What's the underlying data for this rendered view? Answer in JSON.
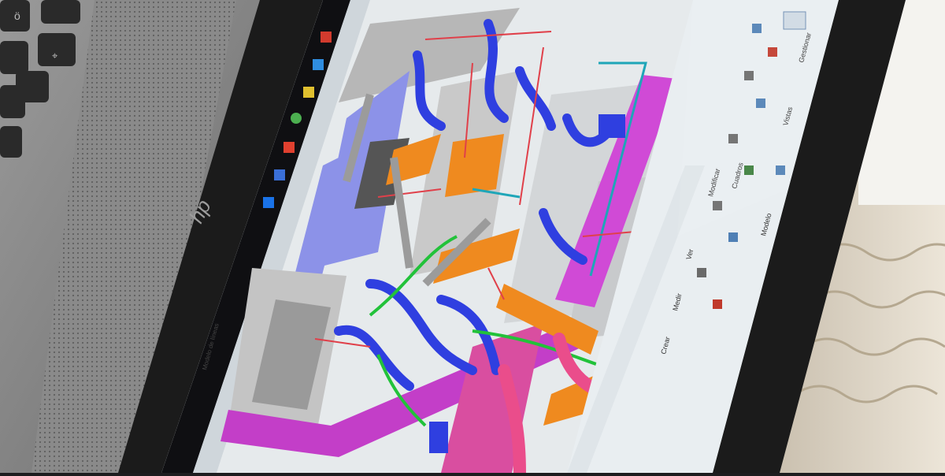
{
  "photo": {
    "subject": "laptop-screen-showing-3d-mep-model",
    "colors": {
      "laptop_body": "#8e8e8e",
      "speaker_grille": "#7a7a7a",
      "bezel": "#1b1b1b",
      "screen_bg": "#dfe6ea",
      "ribbon": "#e9eef1",
      "wall_right": "#d9cdbb",
      "duct_magenta": "#d04ad6",
      "pipe_blue": "#2f3fe0",
      "pipe_orange": "#ef8a1f",
      "pipe_green": "#22c23a",
      "pipe_red": "#e0404a",
      "pipe_cyan": "#1fa6b8",
      "structure_gray": "#b7b7b7",
      "slab_lavender": "#8c92e8"
    }
  },
  "laptop": {
    "logo": "hp-logo-icon"
  },
  "app": {
    "ribbon_labels": [
      "Cuadros",
      "Modificar",
      "Ver",
      "Medir",
      "Crear",
      "Vistas",
      "Modelo",
      "Gestionar"
    ],
    "left_panel_label": "Modelo de líneas"
  }
}
